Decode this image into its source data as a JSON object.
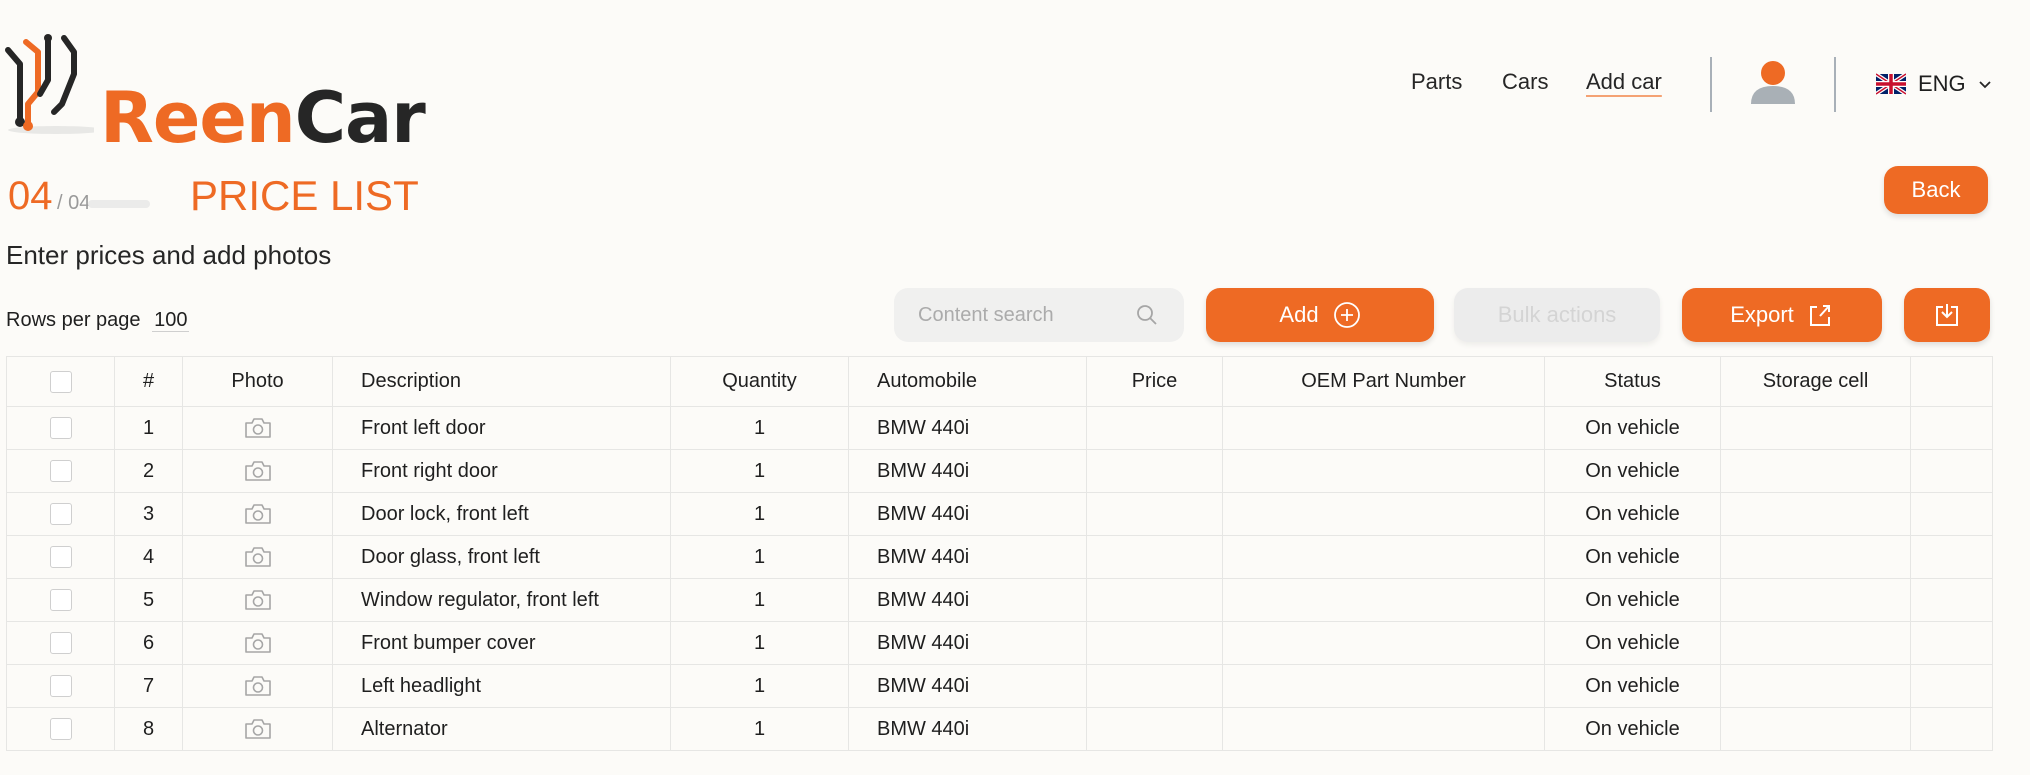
{
  "brand": {
    "name_part1": "Reen",
    "name_part2": "Car",
    "accent": "#ee6a24"
  },
  "nav": {
    "items": [
      "Parts",
      "Cars",
      "Add car"
    ],
    "active": "Add car"
  },
  "language": {
    "label": "ENG",
    "flag": "uk-flag-icon"
  },
  "step": {
    "current": "04",
    "total": "/ 04"
  },
  "page_title": "PRICE LIST",
  "subtitle": "Enter prices and add photos",
  "back_label": "Back",
  "rows_per_page": {
    "label": "Rows per page",
    "value": "100"
  },
  "search": {
    "placeholder": "Content search",
    "value": ""
  },
  "toolbar": {
    "add_label": "Add",
    "bulk_label": "Bulk actions",
    "export_label": "Export"
  },
  "table": {
    "columns": [
      "#",
      "Photo",
      "Description",
      "Quantity",
      "Automobile",
      "Price",
      "OEM Part Number",
      "Status",
      "Storage cell"
    ],
    "rows": [
      {
        "num": "1",
        "description": "Front left door",
        "quantity": "1",
        "automobile": "BMW 440i",
        "price": "",
        "oem": "",
        "status": "On vehicle",
        "storage": ""
      },
      {
        "num": "2",
        "description": "Front right door",
        "quantity": "1",
        "automobile": "BMW 440i",
        "price": "",
        "oem": "",
        "status": "On vehicle",
        "storage": ""
      },
      {
        "num": "3",
        "description": "Door lock, front left",
        "quantity": "1",
        "automobile": "BMW 440i",
        "price": "",
        "oem": "",
        "status": "On vehicle",
        "storage": ""
      },
      {
        "num": "4",
        "description": "Door glass, front left",
        "quantity": "1",
        "automobile": "BMW 440i",
        "price": "",
        "oem": "",
        "status": "On vehicle",
        "storage": ""
      },
      {
        "num": "5",
        "description": "Window regulator, front left",
        "quantity": "1",
        "automobile": "BMW 440i",
        "price": "",
        "oem": "",
        "status": "On vehicle",
        "storage": ""
      },
      {
        "num": "6",
        "description": "Front bumper cover",
        "quantity": "1",
        "automobile": "BMW 440i",
        "price": "",
        "oem": "",
        "status": "On vehicle",
        "storage": ""
      },
      {
        "num": "7",
        "description": "Left headlight",
        "quantity": "1",
        "automobile": "BMW 440i",
        "price": "",
        "oem": "",
        "status": "On vehicle",
        "storage": ""
      },
      {
        "num": "8",
        "description": "Alternator",
        "quantity": "1",
        "automobile": "BMW 440i",
        "price": "",
        "oem": "",
        "status": "On vehicle",
        "storage": ""
      }
    ]
  }
}
